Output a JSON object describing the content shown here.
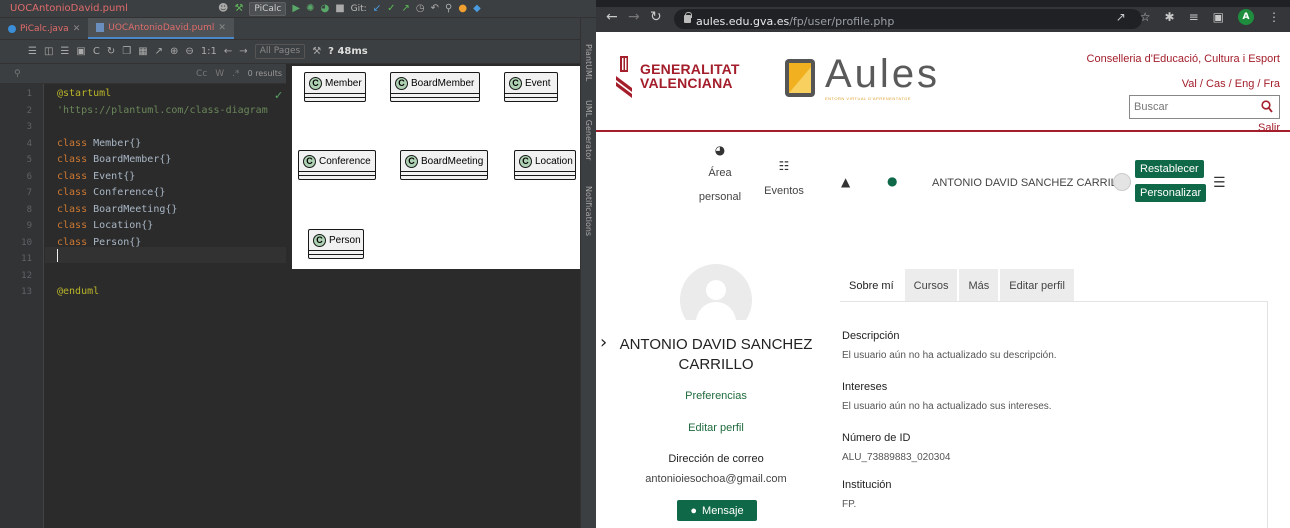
{
  "ide": {
    "title": "UOCAntonioDavid.puml",
    "run_config": "PiCalc",
    "git_label": "Git:",
    "tabs": [
      {
        "label": "PiCalc.java"
      },
      {
        "label": "UOCAntonioDavid.puml"
      }
    ],
    "pages_select": "All Pages",
    "timing": "? 48ms",
    "search": {
      "cc": "Cc",
      "w": "W",
      "results": "0 results"
    },
    "line_numbers": [
      "1",
      "2",
      "3",
      "4",
      "5",
      "6",
      "7",
      "8",
      "9",
      "10",
      "11",
      "12",
      "13"
    ],
    "code": [
      "@startuml",
      "'https://plantuml.com/class-diagram",
      "",
      "class Member{}",
      "class BoardMember{}",
      "class Event{}",
      "class Conference{}",
      "class BoardMeeting{}",
      "class Location{}",
      "class Person{}",
      "",
      "",
      "@enduml"
    ],
    "diagram_classes": [
      "Member",
      "BoardMember",
      "Event",
      "Conference",
      "BoardMeeting",
      "Location",
      "Person"
    ],
    "side_panels": [
      "PlantUML",
      "UML Generator",
      "Notifications"
    ]
  },
  "browser": {
    "url_host": "aules.edu.gva.es",
    "url_path": "/fp/user/profile.php",
    "profile_initial": "A"
  },
  "site": {
    "gv_line1": "GENERALITAT",
    "gv_line2": "VALENCIANA",
    "aules": "Aules",
    "aules_sub": "ENTORN VIRTUAL D'APRENENTATGE",
    "conselleria": "Conselleria d'Educació, Cultura i Esport",
    "langs": "Val / Cas / Eng / Fra",
    "search_placeholder": "Buscar",
    "salir": "Salir",
    "nav": {
      "area_line1": "Área",
      "area_line2": "personal",
      "eventos": "Eventos"
    },
    "username": "ANTONIO DAVID SANCHEZ CARRILLO",
    "restablecer": "Restablecer",
    "personalizar": "Personalizar"
  },
  "profile": {
    "name_line1": "ANTONIO DAVID SANCHEZ",
    "name_line2": "CARRILLO",
    "preferencias": "Preferencias",
    "editar_perfil": "Editar perfil",
    "email_heading": "Dirección de correo",
    "email": "antonioiesochoa@gmail.com",
    "mensaje": "Mensaje",
    "tabs": [
      "Sobre mí",
      "Cursos",
      "Más",
      "Editar perfil"
    ],
    "fields": [
      {
        "label": "Descripción",
        "value": "El usuario aún no ha actualizado su descripción."
      },
      {
        "label": "Intereses",
        "value": "El usuario aún no ha actualizado sus intereses."
      },
      {
        "label": "Número de ID",
        "value": "ALU_73889883_020304"
      },
      {
        "label": "Institución",
        "value": "FP."
      }
    ]
  },
  "colors": {
    "brand_red": "#a31d2a",
    "brand_green": "#0f6848",
    "ide_bg": "#2b2b2b"
  }
}
